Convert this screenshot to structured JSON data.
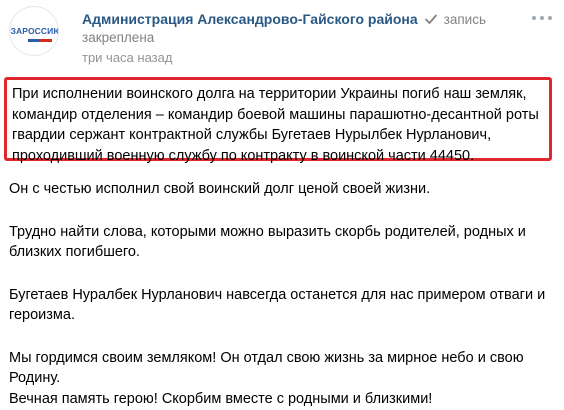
{
  "post": {
    "author": "Администрация Александрово-Гайского района",
    "verified_icon": "verified-check-icon",
    "pinned_part1": "запись",
    "pinned_part2": "закреплена",
    "time": "три часа назад",
    "avatar_tag": "#ЗАРОССИЮ",
    "more_icon": "more-dots-icon",
    "highlight_color": "#e0262e",
    "author_color": "#2a5885"
  },
  "content": {
    "highlight_line1": "При исполнении воинского долга на территории Украины погиб наш земляк,",
    "highlight_line2": "командир отделения – командир боевой машины парашютно-десантной роты",
    "highlight_line3": "гвардии сержант контрактной службы Бугетаев Нурылбек Нурланович,",
    "highlight_line4": "проходивший военную службу по контракту в воинской части 44450.",
    "p1": "Он с честью исполнил свой воинский долг ценой своей жизни.",
    "p2_line1": "Трудно найти слова, которыми можно выразить скорбь родителей, родных и",
    "p2_line2": "близких погибшего.",
    "p3_line1": "Бугетаев Нуралбек Нурланович навсегда останется для нас примером отваги и",
    "p3_line2": "героизма.",
    "p4_line1": "Мы гордимся своим земляком! Он отдал свою жизнь за мирное небо и свою",
    "p4_line2": "Родину.",
    "p5": "Вечная память герою! Скорбим вместе с родными и близкими!"
  }
}
